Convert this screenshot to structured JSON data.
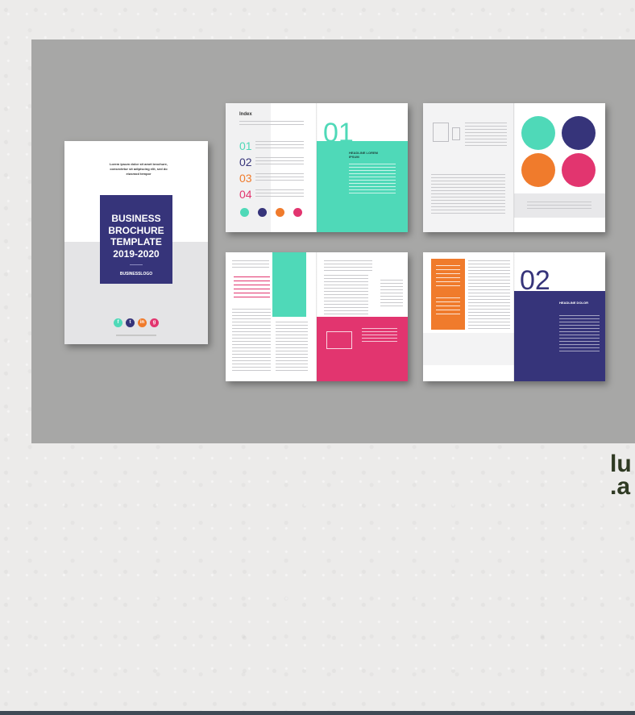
{
  "brochure": {
    "cover": {
      "intro_text": "Lorem ipsum dolor sit amet brochure, consectetur sit adipiscing elit, sed do eiusmod tempor",
      "title": "BUSINESS BROCHURE TEMPLATE 2019-2020",
      "logo_text": "BUSINESSLOGO",
      "social_icons": [
        "facebook-icon",
        "twitter-icon",
        "linkedin-icon",
        "google-plus-icon"
      ]
    },
    "index_spread": {
      "heading": "Index",
      "items": [
        "01",
        "02",
        "03",
        "04"
      ],
      "page_number": "01",
      "headline": "HEADLINE LOREM IPSUM"
    },
    "last_spread": {
      "page_number": "02",
      "headline": "HEADLINE DOLOR"
    }
  },
  "watermark": {
    "line1": "lu",
    "line2": ".a"
  },
  "colors": {
    "navy": "#36347a",
    "teal": "#4fd9b8",
    "orange": "#f07b2c",
    "pink": "#e2356f",
    "stage_gray": "#a7a7a6"
  }
}
